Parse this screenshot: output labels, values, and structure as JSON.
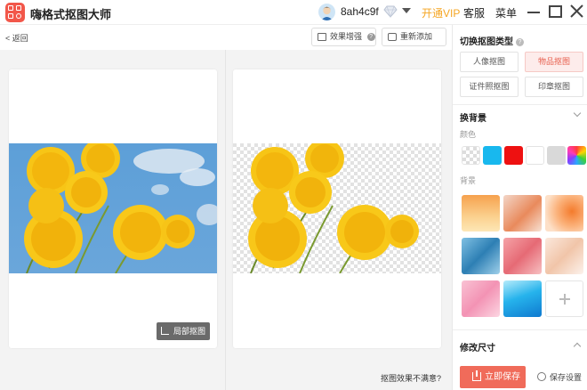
{
  "app": {
    "title": "嗨格式抠图大师",
    "username": "8ah4c9f",
    "vip_link": "开通VIP",
    "service": "客服",
    "menu": "菜单"
  },
  "toolbar": {
    "back": "返回",
    "enhance": "效果增强",
    "readd": "重新添加"
  },
  "preview": {
    "local_cutout": "局部抠图",
    "unsatisfied": "抠图效果不满意?"
  },
  "sidebar": {
    "switch_title": "切换抠图类型",
    "types": [
      {
        "label": "人像抠图",
        "active": false
      },
      {
        "label": "物品抠图",
        "active": true
      },
      {
        "label": "证件照抠图",
        "active": false
      },
      {
        "label": "印章抠图",
        "active": false
      }
    ],
    "change_bg_title": "换背景",
    "color_label": "颜色",
    "colors": [
      "transparent",
      "#18b8ee",
      "#ee1111",
      "#ffffff",
      "#d9d9d9",
      "rainbow"
    ],
    "bg_label": "背景",
    "resize_title": "修改尺寸",
    "save_button": "立即保存",
    "save_settings": "保存设置"
  },
  "colors": {
    "accent": "#f06b5a",
    "vip": "#f5a623"
  }
}
